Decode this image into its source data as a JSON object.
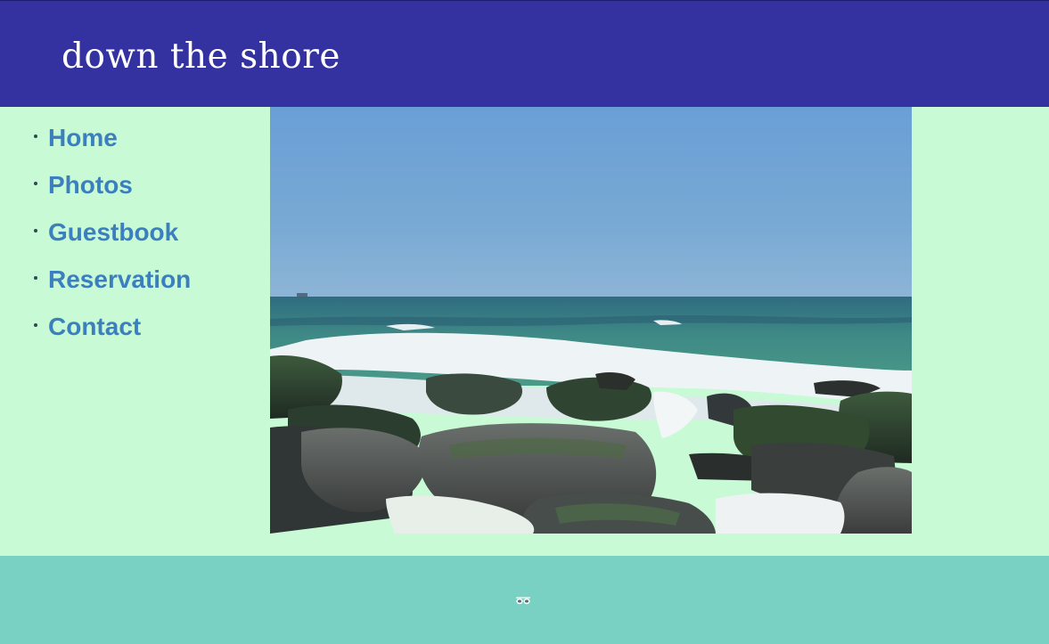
{
  "header": {
    "title": "down the shore"
  },
  "nav": {
    "items": [
      {
        "label": "Home"
      },
      {
        "label": "Photos"
      },
      {
        "label": "Guestbook"
      },
      {
        "label": "Reservation"
      },
      {
        "label": "Contact"
      }
    ]
  },
  "main": {
    "photo_icon": "beach-rocks-photo"
  },
  "footer": {
    "icon": "sunglasses-icon"
  },
  "colors": {
    "header_bg": "#3431a0",
    "body_bg": "#c8fad5",
    "footer_bg": "#78d1c3",
    "link": "#3c7fbe",
    "title": "#ffffff"
  }
}
